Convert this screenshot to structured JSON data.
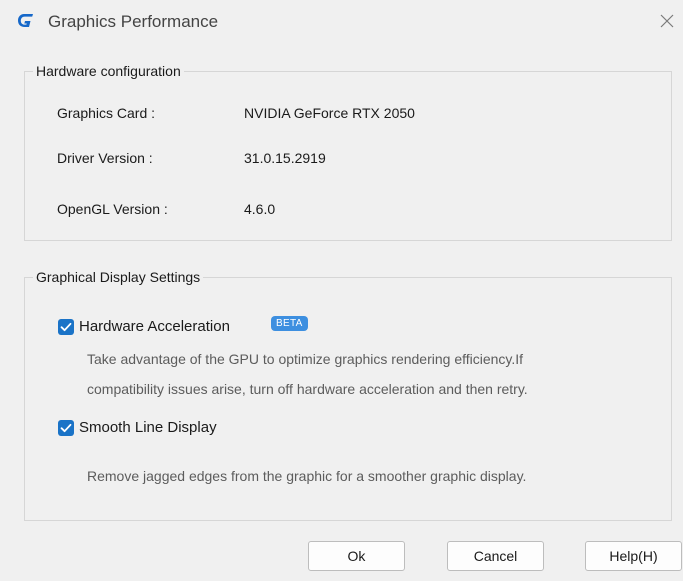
{
  "window": {
    "title": "Graphics Performance"
  },
  "hardware": {
    "legend": "Hardware configuration",
    "graphics_card_label": "Graphics Card :",
    "graphics_card_value": "NVIDIA GeForce RTX 2050",
    "driver_version_label": "Driver Version :",
    "driver_version_value": "31.0.15.2919",
    "opengl_version_label": "OpenGL Version :",
    "opengl_version_value": "4.6.0"
  },
  "display": {
    "legend": "Graphical Display Settings",
    "hw_accel": {
      "label": "Hardware Acceleration",
      "checked": true,
      "badge": "BETA",
      "desc_line1": "Take advantage of the GPU to optimize graphics rendering efficiency.If",
      "desc_line2": "compatibility issues arise, turn off hardware acceleration and then retry."
    },
    "smooth_line": {
      "label": "Smooth Line Display",
      "checked": true,
      "desc": "Remove jagged edges from the graphic for a smoother graphic display."
    }
  },
  "buttons": {
    "ok": "Ok",
    "cancel": "Cancel",
    "help": "Help(H)"
  },
  "colors": {
    "accent": "#1a73c7",
    "badge": "#3d8fe0",
    "background": "#f0f0f0"
  },
  "icons": {
    "app": "app-logo-icon",
    "close": "close-icon",
    "check": "checkmark-icon"
  }
}
